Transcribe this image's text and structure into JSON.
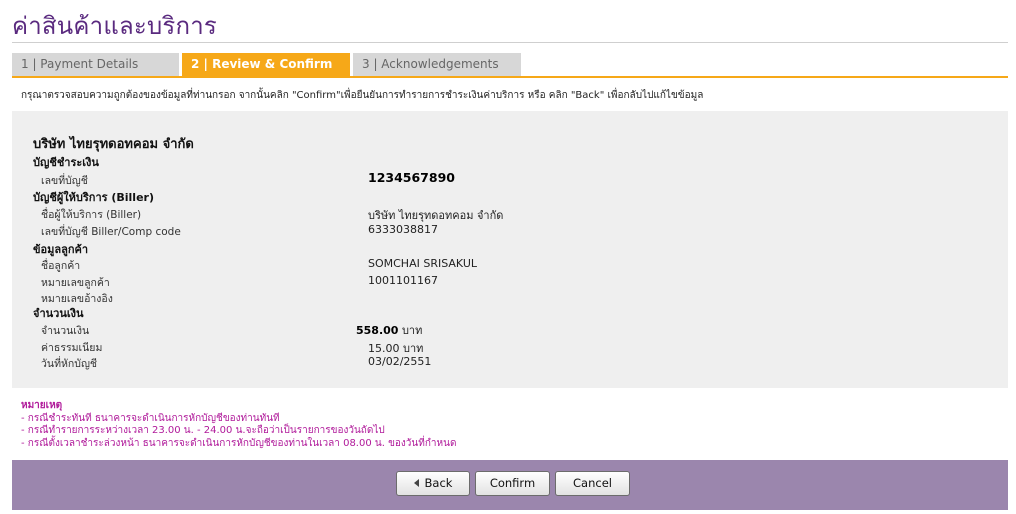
{
  "page": {
    "title": "ค่าสินค้าและบริการ"
  },
  "tabs": [
    {
      "label": "1 | Payment Details",
      "active": false
    },
    {
      "label": "2 | Review & Confirm",
      "active": true
    },
    {
      "label": "3 | Acknowledgements",
      "active": false
    }
  ],
  "instruction": "กรุณาตรวจสอบความถูกต้องของข้อมูลที่ท่านกรอก จากนั้นคลิก \"Confirm\"เพื่อยืนยันการทำรายการชำระเงินค่าบริการ หรือ คลิก \"Back\" เพื่อกลับไปแก้ไขข้อมูล",
  "review": {
    "company": "บริษัท ไทยรุทดอทคอม จำกัด",
    "payment_account": {
      "heading": "บัญชีชำระเงิน",
      "account_no_label": "เลขที่บัญชี",
      "account_no": "1234567890"
    },
    "biller": {
      "heading": "บัญชีผู้ให้บริการ (Biller)",
      "name_label": "ชื่อผู้ให้บริการ (Biller)",
      "name": "บริษัท ไทยรุทดอทคอม จำกัด",
      "code_label": "เลขที่บัญชี Biller/Comp code",
      "code": "6333038817"
    },
    "customer": {
      "heading": "ข้อมูลลูกค้า",
      "name_label": "ชื่อลูกค้า",
      "name": "SOMCHAI SRISAKUL",
      "customer_no_label": "หมายเลขลูกค้า",
      "customer_no": "1001101167",
      "reference_label": "หมายเลขอ้างอิง",
      "reference": ""
    },
    "amount": {
      "heading": "จำนวนเงิน",
      "amount_label": "จำนวนเงิน",
      "amount": "558.00",
      "currency": "บาท",
      "fee_label": "ค่าธรรมเนียม",
      "fee": "15.00 บาท",
      "debit_date_label": "วันที่หักบัญชี",
      "debit_date": "03/02/2551"
    }
  },
  "notes": {
    "title": "หมายเหตุ",
    "items": [
      "- กรณีชำระทันที ธนาคารจะดำเนินการหักบัญชีของท่านทันที",
      "- กรณีทำรายการระหว่างเวลา 23.00 น. - 24.00 น.จะถือว่าเป็นรายการของวันถัดไป",
      "- กรณีตั้งเวลาชำระล่วงหน้า ธนาคารจะดำเนินการหักบัญชีของท่านในเวลา 08.00 น. ของวันที่กำหนด"
    ]
  },
  "buttons": {
    "back": "Back",
    "confirm": "Confirm",
    "cancel": "Cancel"
  },
  "colors": {
    "title": "#5a2a7f",
    "accent": "#f6a818",
    "action_bar": "#9b86ad",
    "notes": "#b01a9a"
  },
  "icons": {
    "back": "arrow-left-icon"
  }
}
